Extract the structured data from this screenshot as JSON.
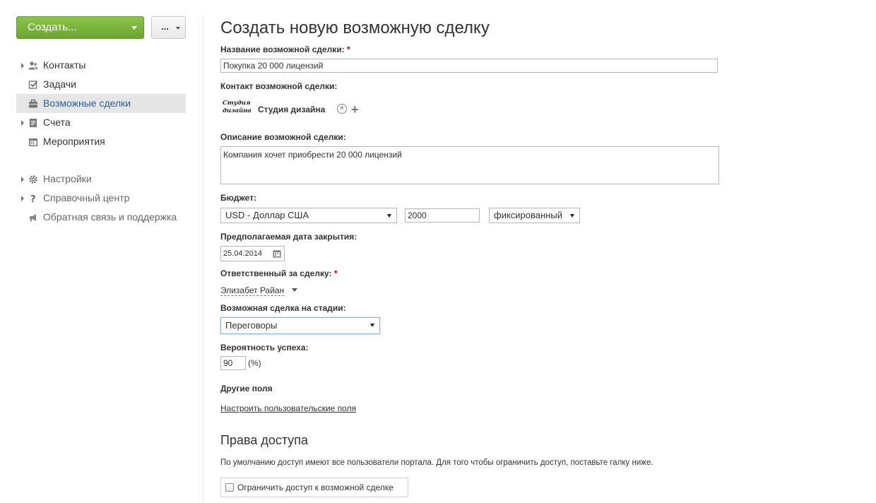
{
  "sidebar": {
    "create_label": "Создать...",
    "more_label": "...",
    "nav_primary": [
      {
        "label": "Контакты",
        "icon": "contacts-icon",
        "has_arrow": true
      },
      {
        "label": "Задачи",
        "icon": "tasks-icon",
        "has_arrow": false
      },
      {
        "label": "Возможные сделки",
        "icon": "deals-icon",
        "has_arrow": false,
        "active": true
      },
      {
        "label": "Счета",
        "icon": "invoices-icon",
        "has_arrow": true
      },
      {
        "label": "Мероприятия",
        "icon": "calendar-icon",
        "has_arrow": false
      }
    ],
    "nav_secondary": [
      {
        "label": "Настройки",
        "icon": "gear-icon",
        "has_arrow": true
      },
      {
        "label": "Справочный центр",
        "icon": "help-icon",
        "has_arrow": true
      },
      {
        "label": "Обратная связь и поддержка",
        "icon": "megaphone-icon",
        "has_arrow": false
      }
    ]
  },
  "form": {
    "title": "Создать новую возможную сделку",
    "name_label": "Название возможной сделки:",
    "name_value": "Покупка 20 000 лицензий",
    "contact_label": "Контакт возможной сделки:",
    "contact_logo_text": "Студия дизайна",
    "contact_name": "Студия дизайна",
    "description_label": "Описание возможной сделки:",
    "description_value": "Компания хочет приобрести 20 000 лицензий",
    "budget_label": "Бюджет:",
    "currency_value": "USD - Доллар США",
    "budget_value": "2000",
    "budget_type_value": "фиксированный",
    "close_date_label": "Предполагаемая дата закрытия:",
    "close_date_value": "25.04.2014",
    "responsible_label": "Ответственный за сделку:",
    "responsible_value": "Элизабет Райан",
    "stage_label": "Возможная сделка на стадии:",
    "stage_value": "Переговоры",
    "probability_label": "Вероятность успеха:",
    "probability_value": "90",
    "probability_unit": "(%)",
    "other_fields_label": "Другие поля",
    "custom_fields_link": "Настроить пользовательские поля",
    "required_mark": "*"
  },
  "access": {
    "title": "Права доступа",
    "description": "По умолчанию доступ имеют все пользователи портала. Для того чтобы ограничить доступ, поставьте галку ниже.",
    "restrict_label": "Ограничить доступ к возможной сделке",
    "restrict_checked": false
  },
  "colors": {
    "create_button": "#76b03a",
    "active_nav_bg": "#e6e6e6",
    "active_nav_text": "#2d5f8e",
    "required": "#c00000"
  }
}
